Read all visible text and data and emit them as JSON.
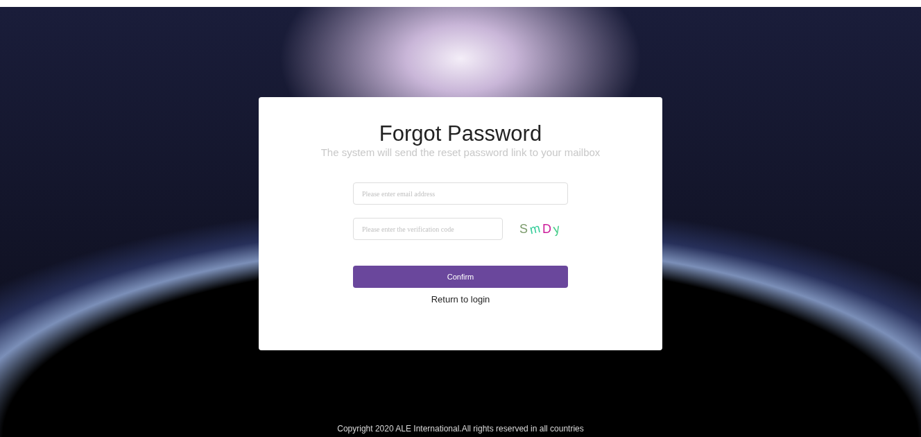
{
  "dialog": {
    "title": "Forgot Password",
    "subtitle": "The system will send the reset password link to your mailbox"
  },
  "email_field": {
    "placeholder": "Please enter email address"
  },
  "code_field": {
    "placeholder": "Please enter the verification code"
  },
  "captcha": [
    {
      "char": "S",
      "color": "#7a9a6a"
    },
    {
      "char": "m",
      "color": "#33cc99"
    },
    {
      "char": "D",
      "color": "#cc1a99"
    },
    {
      "char": "y",
      "color": "#44cc88"
    }
  ],
  "confirm_button": "Confirm",
  "return_link": "Return to login",
  "footer": "Copyright 2020 ALE International.All rights reserved in all countries"
}
